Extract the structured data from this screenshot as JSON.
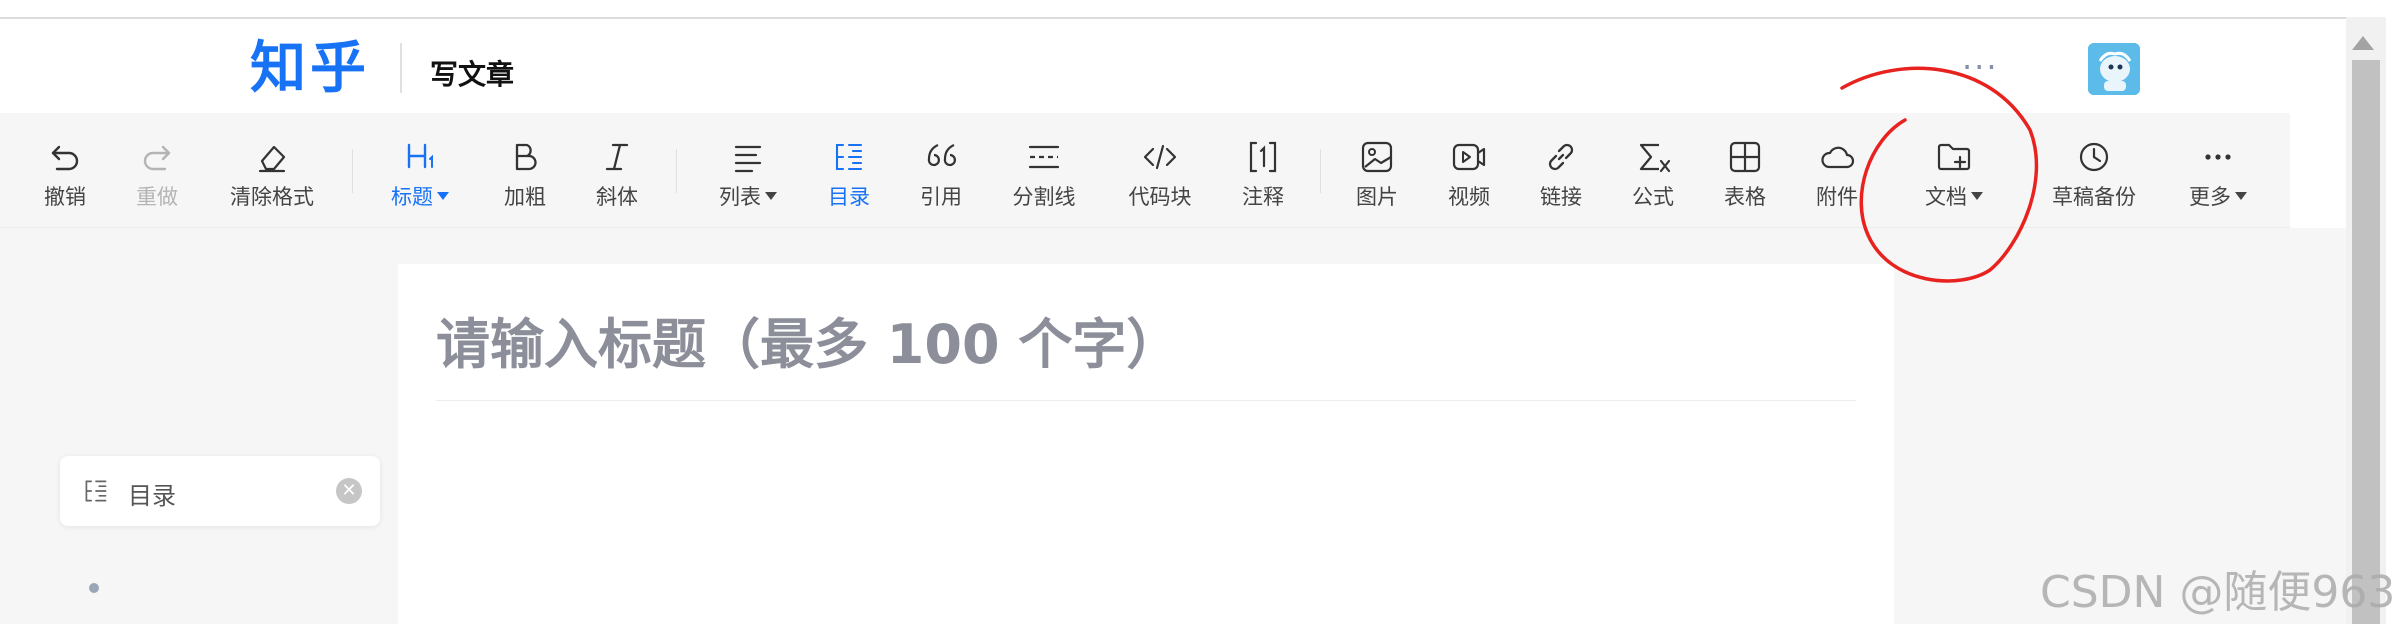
{
  "header": {
    "logo": "知乎",
    "title": "写文章",
    "more": "···"
  },
  "toolbar": {
    "undo": "撤销",
    "redo": "重做",
    "clear_format": "清除格式",
    "heading": "标题",
    "bold": "加粗",
    "italic": "斜体",
    "list": "列表",
    "toc": "目录",
    "quote": "引用",
    "divider": "分割线",
    "code_block": "代码块",
    "footnote": "注释",
    "image": "图片",
    "video": "视频",
    "link": "链接",
    "formula": "公式",
    "table": "表格",
    "attachment": "附件",
    "document": "文档",
    "draft_backup": "草稿备份",
    "more": "更多"
  },
  "editor": {
    "title_placeholder": "请输入标题（最多 100 个字）"
  },
  "toc_panel": {
    "label": "目录"
  },
  "watermark": "CSDN @随便963",
  "colors": {
    "accent": "#1772f6",
    "annotation": "#e8231f"
  }
}
